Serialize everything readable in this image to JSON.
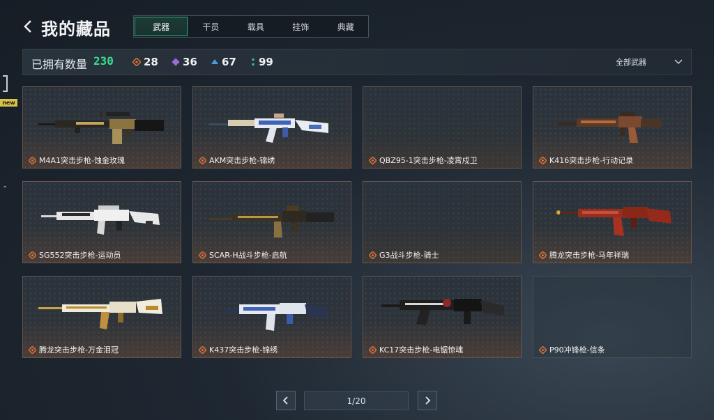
{
  "header": {
    "title": "我的藏品",
    "tabs": [
      {
        "label": "武器",
        "active": true
      },
      {
        "label": "干员",
        "active": false
      },
      {
        "label": "载具",
        "active": false
      },
      {
        "label": "挂饰",
        "active": false
      },
      {
        "label": "典藏",
        "active": false
      }
    ]
  },
  "side": {
    "new_badge": "new"
  },
  "stats": {
    "owned_label": "已拥有数量",
    "owned_count": "230",
    "rarities": [
      {
        "icon": "orange-diamond-icon",
        "color": "#d9703a",
        "count": "28"
      },
      {
        "icon": "purple-diamond-icon",
        "color": "#9a6cd6",
        "count": "36"
      },
      {
        "icon": "blue-chevron-icon",
        "color": "#4f9be0",
        "count": "67"
      },
      {
        "icon": "green-dots-icon",
        "color": "#2fcf7f",
        "count": "99"
      }
    ],
    "filter_label": "全部武器"
  },
  "accent_colors": {
    "active_tab": "#2fae7f",
    "owned_count": "#35e08f",
    "rarity_orange": "#d9703a"
  },
  "weapons": [
    {
      "name": "M4A1突击步枪-蚀金玫瑰",
      "icon": "m4a1-rifle-icon"
    },
    {
      "name": "AKM突击步枪-锦绣",
      "icon": "akm-rifle-icon"
    },
    {
      "name": "QBZ95-1突击步枪-凌霄戍卫",
      "icon": ""
    },
    {
      "name": "K416突击步枪-行动记录",
      "icon": "k416-rifle-icon"
    },
    {
      "name": "SG552突击步枪-运动员",
      "icon": "sg552-rifle-icon"
    },
    {
      "name": "SCAR-H战斗步枪-启航",
      "icon": "scar-h-rifle-icon"
    },
    {
      "name": "G3战斗步枪-骑士",
      "icon": ""
    },
    {
      "name": "腾龙突击步枪-马年祥瑞",
      "icon": "tenglong-rifle-icon"
    },
    {
      "name": "腾龙突击步枪-万金泪冠",
      "icon": "tenglong-gold-rifle-icon"
    },
    {
      "name": "K437突击步枪-锦绣",
      "icon": "k437-rifle-icon"
    },
    {
      "name": "KC17突击步枪-电锯惊魂",
      "icon": "kc17-rifle-icon"
    },
    {
      "name": "P90冲锋枪-信条",
      "icon": ""
    }
  ],
  "pager": {
    "page": "1/20"
  }
}
